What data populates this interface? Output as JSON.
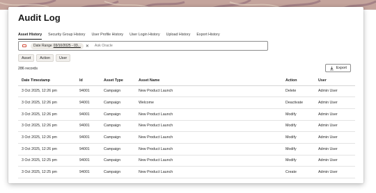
{
  "page": {
    "title": "Audit Log",
    "tabs": [
      {
        "label": "Asset History",
        "active": true
      },
      {
        "label": "Security Group History",
        "active": false
      },
      {
        "label": "User Profile History",
        "active": false
      },
      {
        "label": "User Login History",
        "active": false
      },
      {
        "label": "Upload History",
        "active": false
      },
      {
        "label": "Export History",
        "active": false
      }
    ]
  },
  "search": {
    "chip_label": "Date Range",
    "chip_value": "03/10/2025 - 03...",
    "placeholder": "Ask Oracle"
  },
  "quick_filters": [
    "Asset",
    "Action",
    "User"
  ],
  "records_count": "286 records",
  "export_label": "Export",
  "table": {
    "columns": [
      "Date Timestamp",
      "Id",
      "Asset Type",
      "Asset Name",
      "Action",
      "User"
    ],
    "rows": [
      [
        "3 Oct 2025, 12:26 pm",
        "94001",
        "Campaign",
        "New Product Launch",
        "Delete",
        "Admin User"
      ],
      [
        "3 Oct 2025, 12:26 pm",
        "94001",
        "Campaign",
        "Welcome",
        "Deactivate",
        "Admin User"
      ],
      [
        "3 Oct 2025, 12:26 pm",
        "94001",
        "Campaign",
        "New Product Launch",
        "Modify",
        "Admin User"
      ],
      [
        "3 Oct 2025, 12:26 pm",
        "94001",
        "Campaign",
        "New Product Launch",
        "Modify",
        "Admin User"
      ],
      [
        "3 Oct 2025, 12:26 pm",
        "94001",
        "Campaign",
        "New Product Launch",
        "Modify",
        "Admin User"
      ],
      [
        "3 Oct 2025, 12:26 pm",
        "94001",
        "Campaign",
        "New Product Launch",
        "Modify",
        "Admin User"
      ],
      [
        "3 Oct 2025, 12:25 pm",
        "94001",
        "Campaign",
        "New Product Launch",
        "Modify",
        "Admin User"
      ],
      [
        "3 Oct 2025, 12:25 pm",
        "94001",
        "Campaign",
        "New Product Launch",
        "Create",
        "Admin User"
      ]
    ]
  },
  "colors": {
    "banner": "#c7a9a1",
    "accent": "#d24d3a"
  },
  "icons": {
    "filter": "filter-icon",
    "close": "close-icon",
    "export": "download-icon"
  }
}
